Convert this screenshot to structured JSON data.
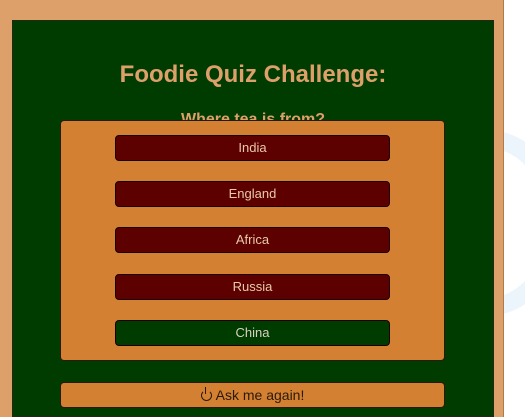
{
  "quiz": {
    "title": "Foodie Quiz Challenge:",
    "question": "Where tea is from?",
    "options": [
      {
        "label": "India",
        "state": "wrong"
      },
      {
        "label": "England",
        "state": "wrong"
      },
      {
        "label": "Africa",
        "state": "wrong"
      },
      {
        "label": "Russia",
        "state": "wrong"
      },
      {
        "label": "China",
        "state": "correct"
      }
    ],
    "again_label": "Ask me again!",
    "again_icon": "power-icon"
  },
  "colors": {
    "frame": "#dda06a",
    "panel": "#003b00",
    "options_box": "#d48033",
    "wrong": "#5c0000",
    "correct": "#003b00",
    "title_text": "#dda06a"
  }
}
